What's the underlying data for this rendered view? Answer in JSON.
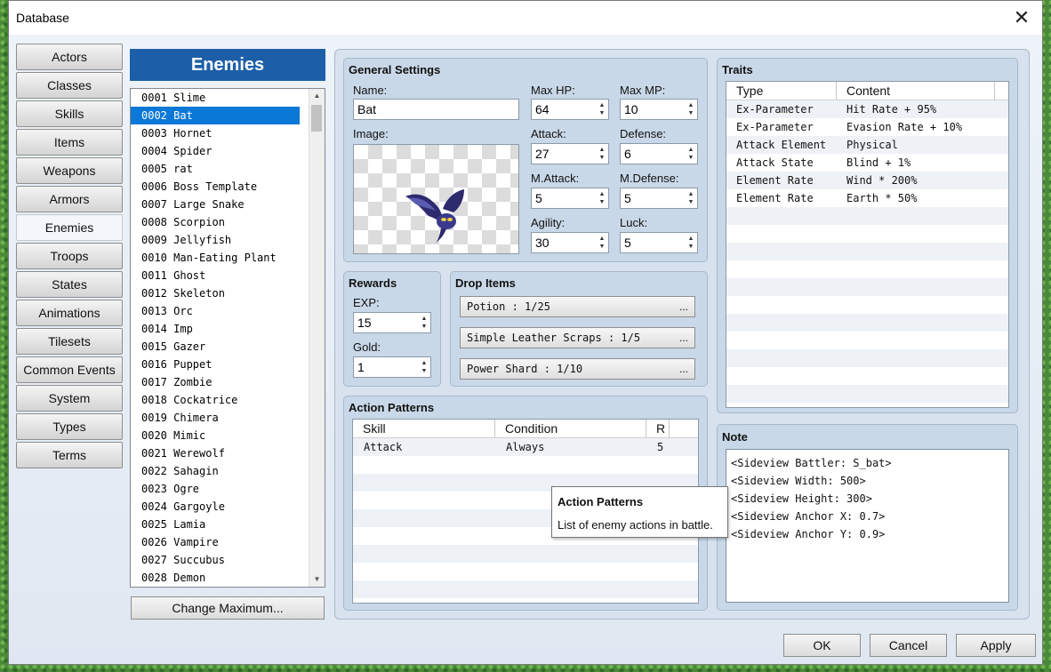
{
  "window": {
    "title": "Database",
    "close_glyph": "✕"
  },
  "categories": [
    {
      "label": "Actors"
    },
    {
      "label": "Classes"
    },
    {
      "label": "Skills"
    },
    {
      "label": "Items"
    },
    {
      "label": "Weapons"
    },
    {
      "label": "Armors"
    },
    {
      "label": "Enemies"
    },
    {
      "label": "Troops"
    },
    {
      "label": "States"
    },
    {
      "label": "Animations"
    },
    {
      "label": "Tilesets"
    },
    {
      "label": "Common Events"
    },
    {
      "label": "System"
    },
    {
      "label": "Types"
    },
    {
      "label": "Terms"
    }
  ],
  "active_category": "Enemies",
  "enemy_list": {
    "header": "Enemies",
    "selected": "0002 Bat",
    "items": [
      "0001 Slime",
      "0002 Bat",
      "0003 Hornet",
      "0004 Spider",
      "0005 rat",
      "0006 Boss Template",
      "0007 Large Snake",
      "0008 Scorpion",
      "0009 Jellyfish",
      "0010 Man-Eating Plant",
      "0011 Ghost",
      "0012 Skeleton",
      "0013 Orc",
      "0014 Imp",
      "0015 Gazer",
      "0016 Puppet",
      "0017 Zombie",
      "0018 Cockatrice",
      "0019 Chimera",
      "0020 Mimic",
      "0021 Werewolf",
      "0022 Sahagin",
      "0023 Ogre",
      "0024 Gargoyle",
      "0025 Lamia",
      "0026 Vampire",
      "0027 Succubus",
      "0028 Demon"
    ],
    "change_max_label": "Change Maximum..."
  },
  "general": {
    "title": "General Settings",
    "name_label": "Name:",
    "name_value": "Bat",
    "image_label": "Image:",
    "maxhp_label": "Max HP:",
    "maxhp_value": "64",
    "maxmp_label": "Max MP:",
    "maxmp_value": "10",
    "attack_label": "Attack:",
    "attack_value": "27",
    "defense_label": "Defense:",
    "defense_value": "6",
    "mattack_label": "M.Attack:",
    "mattack_value": "5",
    "mdefense_label": "M.Defense:",
    "mdefense_value": "5",
    "agility_label": "Agility:",
    "agility_value": "30",
    "luck_label": "Luck:",
    "luck_value": "5"
  },
  "rewards": {
    "title": "Rewards",
    "exp_label": "EXP:",
    "exp_value": "15",
    "gold_label": "Gold:",
    "gold_value": "1"
  },
  "drops": {
    "title": "Drop Items",
    "items": [
      "Potion : 1/25",
      "Simple Leather Scraps : 1/5",
      "Power Shard : 1/10"
    ],
    "dots": "..."
  },
  "action_patterns": {
    "title": "Action Patterns",
    "columns": [
      "Skill",
      "Condition",
      "R"
    ],
    "rows": [
      {
        "skill": "Attack",
        "condition": "Always",
        "r": "5"
      }
    ]
  },
  "tooltip": {
    "title": "Action Patterns",
    "text": "List of enemy actions in battle."
  },
  "traits": {
    "title": "Traits",
    "columns": [
      "Type",
      "Content"
    ],
    "rows": [
      {
        "type": "Ex-Parameter",
        "content": "Hit Rate + 95%"
      },
      {
        "type": "Ex-Parameter",
        "content": "Evasion Rate + 10%"
      },
      {
        "type": "Attack Element",
        "content": "Physical"
      },
      {
        "type": "Attack State",
        "content": "Blind + 1%"
      },
      {
        "type": "Element Rate",
        "content": "Wind * 200%"
      },
      {
        "type": "Element Rate",
        "content": "Earth * 50%"
      }
    ]
  },
  "note": {
    "title": "Note",
    "lines": [
      "<Sideview Battler: S_bat>",
      "<Sideview Width: 500>",
      "<Sideview Height: 300>",
      "<Sideview Anchor X: 0.7>",
      "<Sideview Anchor Y: 0.9>"
    ]
  },
  "footer": {
    "ok": "OK",
    "cancel": "Cancel",
    "apply": "Apply"
  },
  "colors": {
    "accent": "#1c5fa8",
    "selection": "#0a78d7",
    "panel": "#c9d8e8"
  },
  "icons": [
    "close-icon",
    "scroll-up-icon",
    "scroll-down-icon",
    "spinner-icon",
    "bat-sprite"
  ]
}
